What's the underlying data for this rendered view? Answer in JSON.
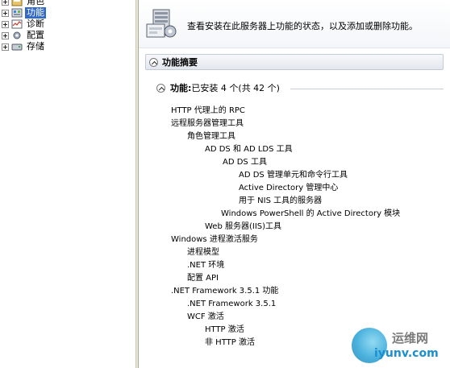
{
  "tree": {
    "items": [
      {
        "label": "角色"
      },
      {
        "label": "功能"
      },
      {
        "label": "诊断"
      },
      {
        "label": "配置"
      },
      {
        "label": "存储"
      }
    ]
  },
  "banner": {
    "text": "查看安装在此服务器上功能的状态，以及添加或删除功能。"
  },
  "summary": {
    "title": "功能摘要"
  },
  "features": {
    "label": "功能:",
    "count": " 已安装 4 个(共 42 个)",
    "items": [
      "HTTP 代理上的 RPC",
      "远程服务器管理工具",
      "角色管理工具",
      "AD DS 和 AD LDS 工具",
      "AD DS 工具",
      "AD DS 管理单元和命令行工具",
      "Active Directory 管理中心",
      "用于 NIS 工具的服务器",
      "Windows PowerShell 的 Active Directory 模块",
      "Web 服务器(IIS)工具",
      "Windows 进程激活服务",
      "进程模型",
      ".NET 环境",
      "配置 API",
      ".NET Framework 3.5.1 功能",
      ".NET Framework 3.5.1",
      "WCF 激活",
      "HTTP 激活",
      "非 HTTP 激活"
    ]
  },
  "watermark": {
    "top": "运维网",
    "bottom": "iyunv.com"
  }
}
